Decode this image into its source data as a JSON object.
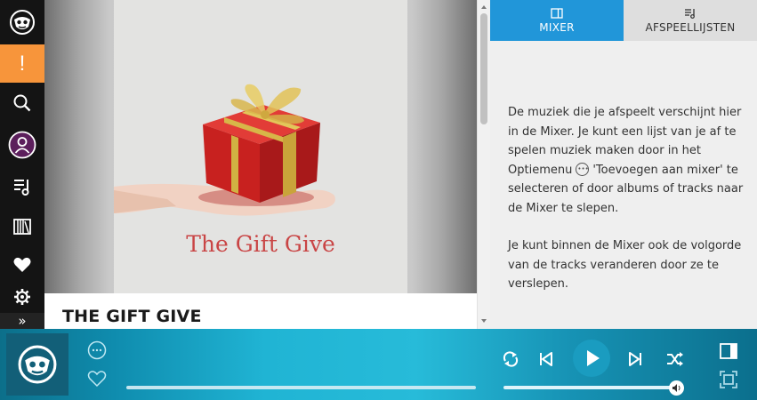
{
  "nav": {
    "items": [
      {
        "name": "logo",
        "icon": "napster-logo-icon"
      },
      {
        "name": "alert",
        "icon": "exclamation-icon",
        "label": "!"
      },
      {
        "name": "search",
        "icon": "search-icon"
      },
      {
        "name": "profile",
        "icon": "user-icon"
      },
      {
        "name": "playlists",
        "icon": "playlist-icon"
      },
      {
        "name": "library",
        "icon": "library-icon"
      },
      {
        "name": "favorites",
        "icon": "heart-icon"
      },
      {
        "name": "settings",
        "icon": "gear-icon"
      },
      {
        "name": "expand",
        "icon": "chevron-double-right-icon",
        "label": "»"
      }
    ]
  },
  "album": {
    "cover_text": "The Gift Give",
    "title": "THE GIFT GIVE"
  },
  "panel": {
    "tabs": [
      {
        "label": "MIXER",
        "icon": "mixer-icon",
        "active": true
      },
      {
        "label": "AFSPEELLIJSTEN",
        "icon": "playlist-icon",
        "active": false
      }
    ],
    "paragraph1_a": "De muziek die je afspeelt verschijnt hier in de Mixer. Je kunt een lijst van je af te spelen muziek maken door in het Optiemenu",
    "paragraph1_b": "'Toevoegen aan mixer' te selecteren of door albums of tracks naar de Mixer te slepen.",
    "paragraph2": "Je kunt binnen de Mixer ook de volgorde van de tracks veranderen door ze te verslepen."
  },
  "player": {
    "icons": [
      "options-icon",
      "heart-icon",
      "repeat-icon",
      "previous-icon",
      "play-icon",
      "next-icon",
      "shuffle-icon",
      "mixer-panel-icon",
      "fullscreen-icon",
      "volume-icon"
    ],
    "track_progress": 0,
    "volume": 1.0
  },
  "colors": {
    "accent": "#2196d9",
    "alert": "#f7953b",
    "cover_text": "#c94545",
    "nav_bg": "#141414"
  }
}
